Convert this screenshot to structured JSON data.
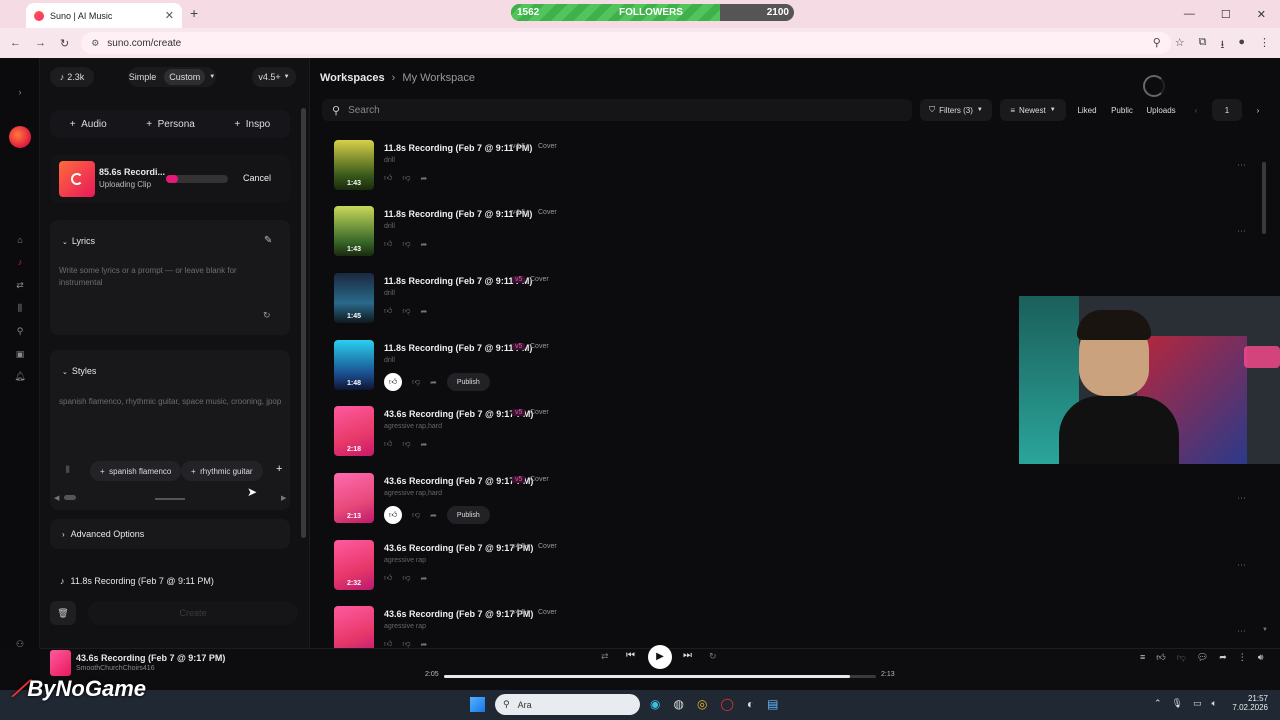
{
  "browser": {
    "tab_title": "Suno | AI Music",
    "url": "suno.com/create",
    "followers": {
      "current": "1562",
      "label": "FOLLOWERS",
      "target": "2100",
      "progress": 0.74
    }
  },
  "panel": {
    "credits": "2.3k",
    "mode_simple": "Simple",
    "mode_custom": "Custom",
    "model": "v4.5+",
    "add_audio": "Audio",
    "add_persona": "Persona",
    "add_inspo": "Inspo",
    "upload": {
      "title": "85.6s Recordi...",
      "status": "Uploading Clip",
      "cancel": "Cancel",
      "progress": 0.2
    },
    "lyrics_label": "Lyrics",
    "lyrics_placeholder": "Write some lyrics or a prompt — or leave blank for instrumental",
    "styles_label": "Styles",
    "styles_value": "spanish flamenco, rhythmic guitar, space music, crooning, jpop",
    "style_tags": [
      "spanish flamenco",
      "rhythmic guitar"
    ],
    "advanced": "Advanced Options",
    "selected_song": "11.8s Recording (Feb 7 @ 9:11 PM)",
    "create": "Create"
  },
  "main": {
    "breadcrumb_root": "Workspaces",
    "breadcrumb_current": "My Workspace",
    "search_placeholder": "Search",
    "filters": "Filters (3)",
    "sort": "Newest",
    "liked": "Liked",
    "public": "Public",
    "uploads": "Uploads",
    "page": "1",
    "publish": "Publish",
    "songs": [
      {
        "title": "11.8s Recording (Feb 7 @ 9:11 PM)",
        "version": "v4.5+",
        "type": "Cover",
        "style": "drill",
        "duration": "1:43",
        "liked": false
      },
      {
        "title": "11.8s Recording (Feb 7 @ 9:11 PM)",
        "version": "v4.5+",
        "type": "Cover",
        "style": "drill",
        "duration": "1:43",
        "liked": false
      },
      {
        "title": "11.8s Recording (Feb 7 @ 9:11 PM)",
        "version": "v5",
        "type": "Cover",
        "style": "drill",
        "duration": "1:45",
        "liked": false
      },
      {
        "title": "11.8s Recording (Feb 7 @ 9:11 PM)",
        "version": "v5",
        "type": "Cover",
        "style": "drill",
        "duration": "1:48",
        "liked": true
      },
      {
        "title": "43.6s Recording (Feb 7 @ 9:17 PM)",
        "version": "v5",
        "type": "Cover",
        "style": "agressive rap,hard",
        "duration": "2:18",
        "liked": false
      },
      {
        "title": "43.6s Recording (Feb 7 @ 9:17 PM)",
        "version": "v5",
        "type": "Cover",
        "style": "agressive rap,hard",
        "duration": "2:13",
        "liked": true
      },
      {
        "title": "43.6s Recording (Feb 7 @ 9:17 PM)",
        "version": "v4.5+",
        "type": "Cover",
        "style": "agressive rap",
        "duration": "2:32",
        "liked": false
      },
      {
        "title": "43.6s Recording (Feb 7 @ 9:17 PM)",
        "version": "v4.5+",
        "type": "Cover",
        "style": "agressive rap",
        "duration": "",
        "liked": false
      }
    ]
  },
  "player": {
    "title": "43.6s Recording (Feb 7 @ 9:17 PM)",
    "artist": "SmoothChurchChoirs416",
    "elapsed": "2:05",
    "total": "2:13",
    "progress": 0.94
  },
  "taskbar": {
    "search": "Ara",
    "time": "21:57",
    "date": "7.02.2026"
  },
  "watermark": "ByNoGame",
  "colors": {
    "accent": "#e8185a",
    "bg": "#0c0c0e"
  }
}
